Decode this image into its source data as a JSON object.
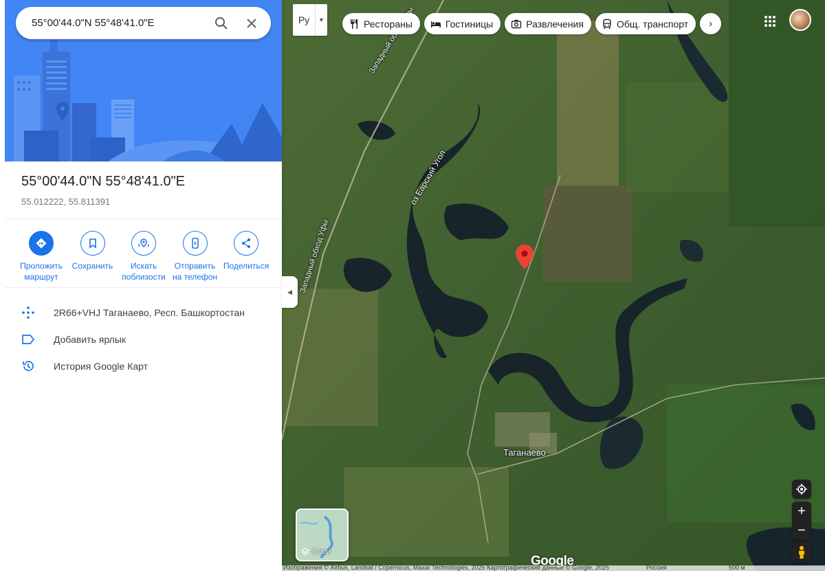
{
  "search": {
    "value": "55°00'44.0\"N 55°48'41.0\"E"
  },
  "place": {
    "title": "55°00'44.0\"N 55°48'41.0\"E",
    "coords": "55.012222, 55.811391"
  },
  "actions": [
    {
      "line1": "Проложить",
      "line2": "маршрут",
      "icon": "directions-icon"
    },
    {
      "line1": "Сохранить",
      "line2": "",
      "icon": "bookmark-icon"
    },
    {
      "line1": "Искать",
      "line2": "поблизости",
      "icon": "nearby-icon"
    },
    {
      "line1": "Отправить",
      "line2": "на телефон",
      "icon": "phone-icon"
    },
    {
      "line1": "Поделиться",
      "line2": "",
      "icon": "share-icon"
    }
  ],
  "info": {
    "plus_code": "2R66+VHJ Таганаево, Респ. Башкортостан",
    "add_label": "Добавить ярлык",
    "history": "История Google Карт"
  },
  "map": {
    "view_toggle": "Ру",
    "chips": [
      {
        "label": "Рестораны",
        "icon": "restaurant-icon"
      },
      {
        "label": "Гостиницы",
        "icon": "hotel-icon"
      },
      {
        "label": "Развлечения",
        "icon": "camera-icon"
      },
      {
        "label": "Общ. транспорт",
        "icon": "transit-icon"
      }
    ],
    "labels": {
      "road1": "Западный обход Уфы",
      "road2": "Западный обход Уфы",
      "lake": "оз Еарский Угол",
      "village": "Таганаево"
    },
    "layers_label": "Слои",
    "logo": "Google",
    "attribution": "Изображения © Airbus, Landsat / Copernicus, Maxar Technologies, 2025 Картографические данные © Google, 2025",
    "attribution_right": "Россия",
    "scale": "500 м"
  },
  "colors": {
    "accent": "#1a73e8",
    "hero": "#4285f4",
    "pin": "#ea4335"
  }
}
